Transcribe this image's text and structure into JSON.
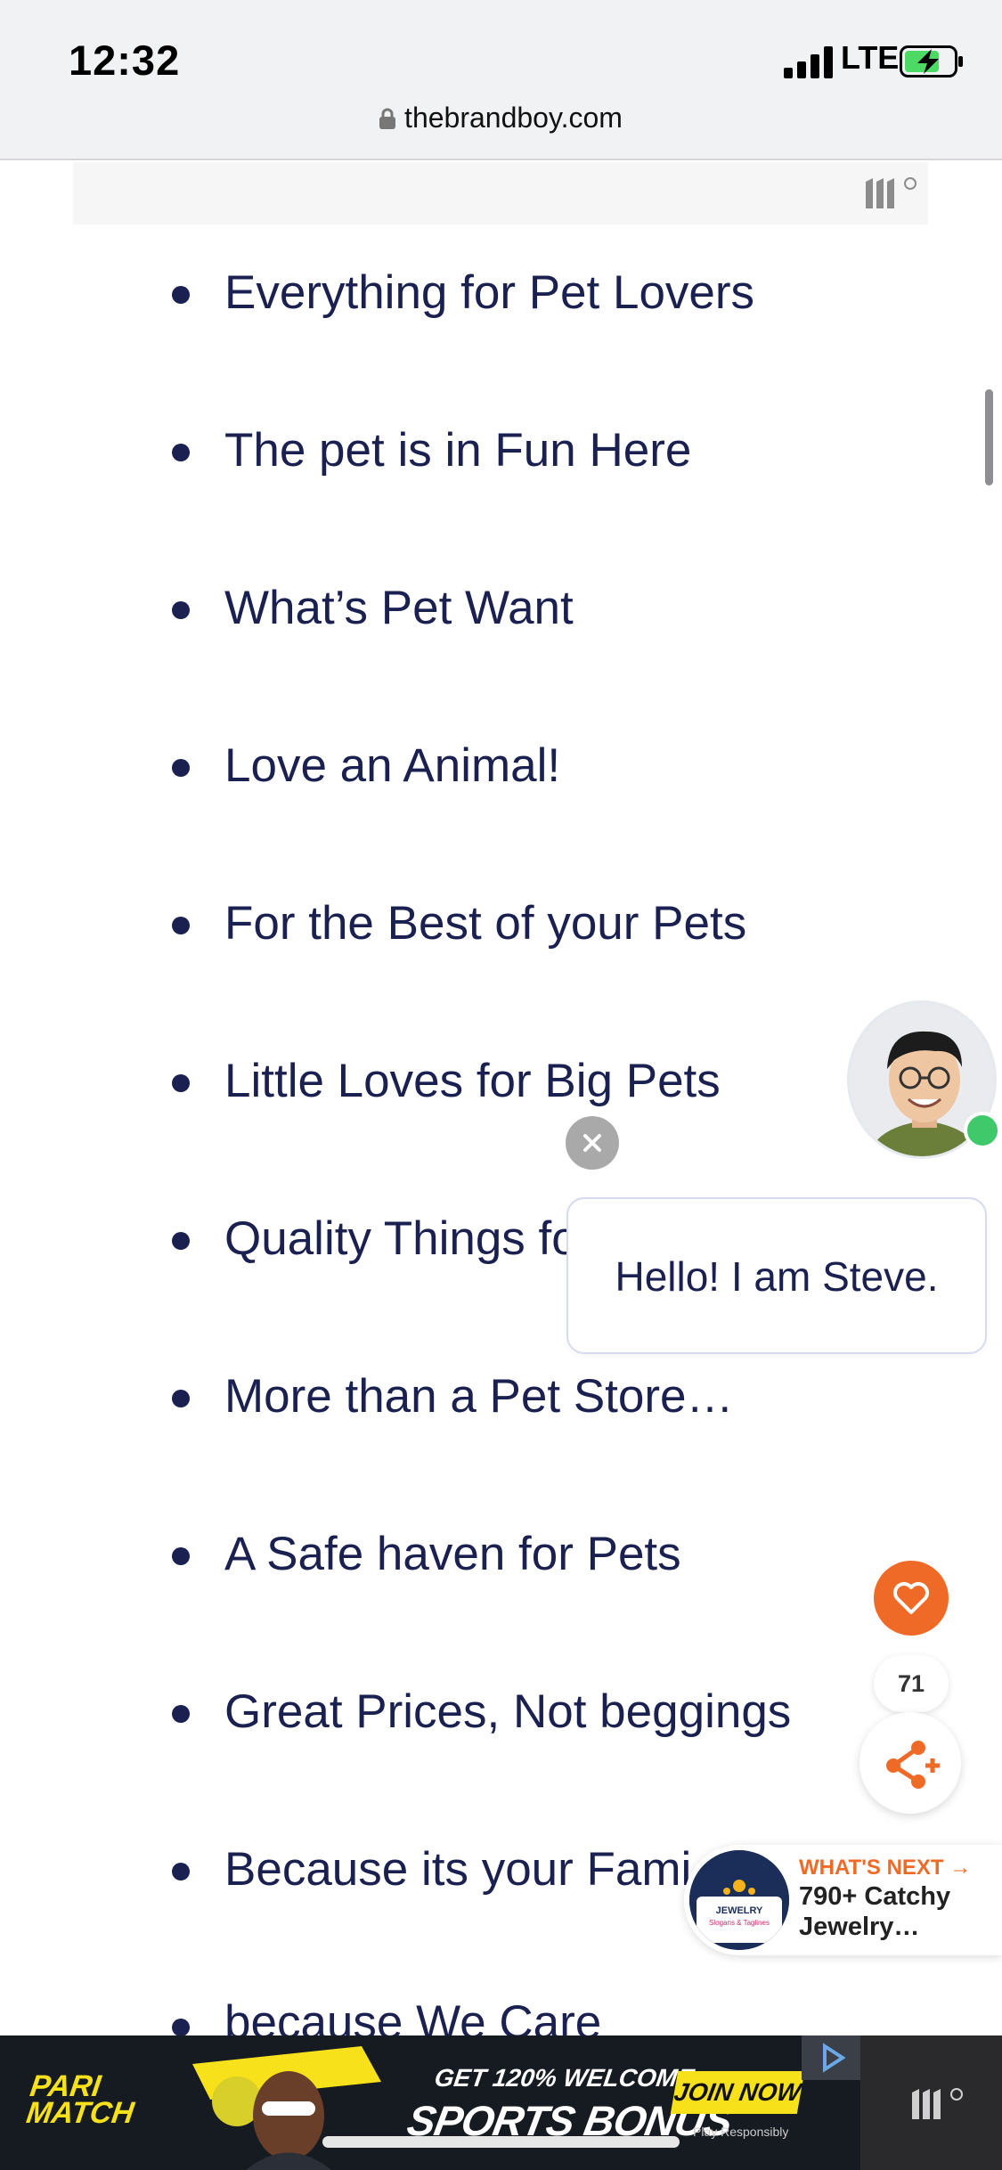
{
  "status_bar": {
    "time": "12:32",
    "network": "LTE"
  },
  "browser": {
    "url": "thebrandboy.com"
  },
  "slogans": [
    "Everything for Pet Lovers",
    "The pet is in Fun Here",
    "What’s Pet Want",
    "Love an Animal!",
    "For the Best of your Pets",
    "Little Loves for Big Pets",
    "Quality Things fo",
    "More than a Pet Store…",
    "A Safe haven for Pets",
    "Great Prices, Not beggings",
    "Because its your Fami",
    "because We Care"
  ],
  "chat": {
    "greeting": "Hello! I am Steve."
  },
  "social": {
    "like_count": "71"
  },
  "whats_next": {
    "heading": "WHAT'S NEXT →",
    "title": "790+ Catchy Jewelry…",
    "thumb_label": "JEWELRY",
    "thumb_sub": "Slogans & Taglines"
  },
  "ad": {
    "brand_line1": "PARI",
    "brand_line2": "MATCH",
    "offer_top": "GET 120% WELCOME",
    "offer_main": "SPORTS BONUS",
    "cta": "JOIN NOW",
    "disclaimer": "Play Responsibly"
  },
  "colors": {
    "text_primary": "#1a2151",
    "accent_orange": "#ef6a27",
    "online_green": "#3fc96a",
    "ad_yellow": "#f6e11b"
  }
}
